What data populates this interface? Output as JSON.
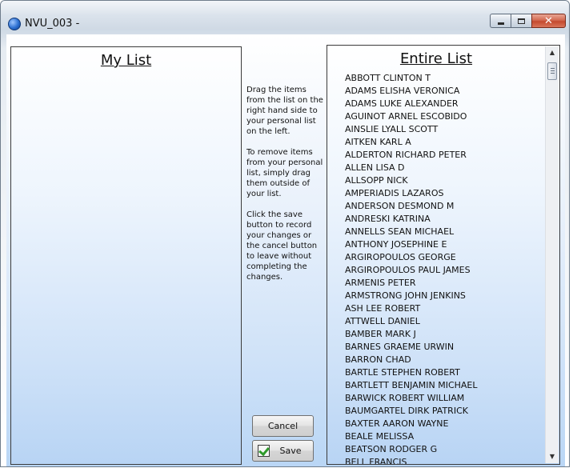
{
  "window": {
    "title": "NVU_003 -"
  },
  "my_list": {
    "title": "My List"
  },
  "entire_list": {
    "title": "Entire List",
    "items": [
      "ABBOTT CLINTON T",
      "ADAMS ELISHA VERONICA",
      "ADAMS LUKE ALEXANDER",
      "AGUINOT ARNEL ESCOBIDO",
      "AINSLIE LYALL SCOTT",
      "AITKEN KARL A",
      "ALDERTON RICHARD PETER",
      "ALLEN LISA D",
      "ALLSOPP NICK",
      "AMPERIADIS LAZAROS",
      "ANDERSON DESMOND M",
      "ANDRESKI KATRINA",
      "ANNELLS SEAN MICHAEL",
      "ANTHONY JOSEPHINE E",
      "ARGIROPOULOS GEORGE",
      "ARGIROPOULOS PAUL JAMES",
      "ARMENIS PETER",
      "ARMSTRONG JOHN JENKINS",
      "ASH LEE ROBERT",
      "ATTWELL DANIEL",
      "BAMBER MARK J",
      "BARNES GRAEME URWIN",
      "BARRON CHAD",
      "BARTLE STEPHEN ROBERT",
      "BARTLETT BENJAMIN MICHAEL",
      "BARWICK ROBERT WILLIAM",
      "BAUMGARTEL DIRK PATRICK",
      "BAXTER AARON WAYNE",
      "BEALE MELISSA",
      "BEATSON RODGER G",
      "BELL FRANCIS"
    ]
  },
  "instructions": {
    "p1": "Drag the items from the list on the right hand side to your personal list on the left.",
    "p2": "To remove items from your personal list, simply drag them outside of your list.",
    "p3": "Click the save button to record your changes or the cancel button to leave without completing the changes."
  },
  "buttons": {
    "cancel_label": "Cancel",
    "save_label": "Save"
  },
  "icons": {
    "app": "app-globe-icon",
    "save": "save-check-icon",
    "minimize": "minimize-icon",
    "maximize": "maximize-icon",
    "close": "close-icon",
    "scroll_up": "scroll-up-arrow-icon",
    "scroll_down": "scroll-down-arrow-icon"
  }
}
